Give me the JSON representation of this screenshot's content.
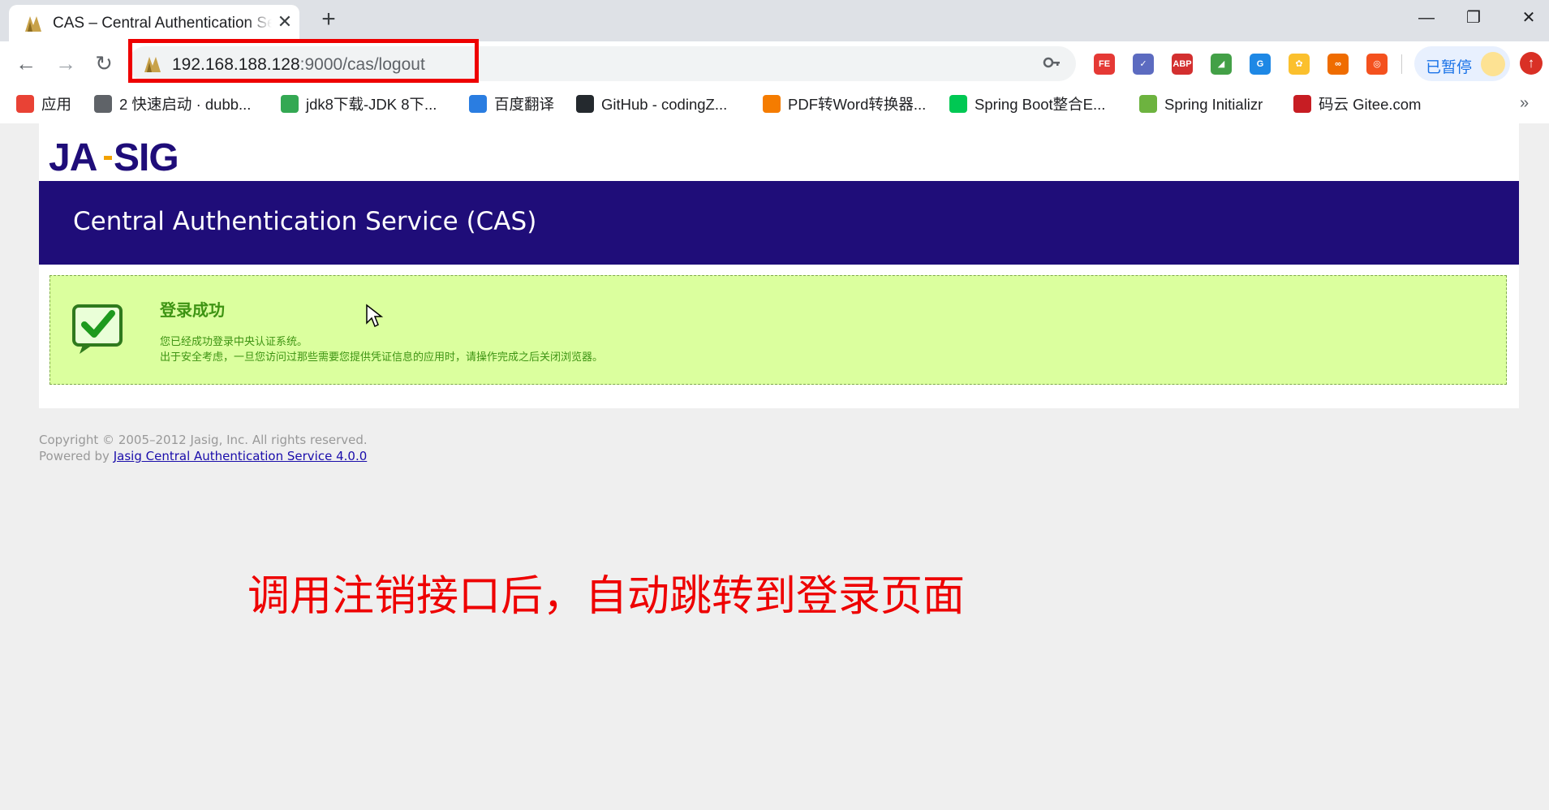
{
  "tab": {
    "title": "CAS – Central Authentication Service",
    "close": "✕"
  },
  "new_tab": "+",
  "window_controls": {
    "minimize": "—",
    "restore": "❐",
    "close": "✕"
  },
  "nav": {
    "back": "←",
    "forward": "→",
    "reload": "↻"
  },
  "omnibox": {
    "host": "192.168.188.128",
    "path": ":9000/cas/logout",
    "key_icon": "key-icon"
  },
  "extensions": [
    {
      "name": "fe-helper-icon",
      "label": "FE",
      "color": "#e53935"
    },
    {
      "name": "check-circle-icon",
      "label": "✓",
      "color": "#5c6bc0"
    },
    {
      "name": "adblock-icon",
      "label": "ABP",
      "color": "#d32f2f"
    },
    {
      "name": "color-picker-icon",
      "label": "◢",
      "color": "#43a047"
    },
    {
      "name": "translate-icon",
      "label": "G",
      "color": "#1e88e5"
    },
    {
      "name": "photos-icon",
      "label": "✿",
      "color": "#fbc02d"
    },
    {
      "name": "infinity-icon",
      "label": "∞",
      "color": "#ef6c00"
    },
    {
      "name": "lifebuoy-icon",
      "label": "◎",
      "color": "#f4511e"
    }
  ],
  "profile": {
    "label": "已暂停"
  },
  "update_badge": "↑",
  "bookmarks": [
    {
      "label": "应用",
      "icon": "apps-grid-icon",
      "color": "#e94235"
    },
    {
      "label": "2 快速启动 · dubb...",
      "icon": "book-icon",
      "color": "#5f6368"
    },
    {
      "label": "jdk8下载-JDK 8下...",
      "icon": "green-g-icon",
      "color": "#34a853"
    },
    {
      "label": "百度翻译",
      "icon": "translate-bookmark-icon",
      "color": "#2a7de1"
    },
    {
      "label": "GitHub - codingZ...",
      "icon": "github-icon",
      "color": "#24292e"
    },
    {
      "label": "PDF转Word转换器...",
      "icon": "pdf-plus-icon",
      "color": "#f57c00"
    },
    {
      "label": "Spring Boot整合E...",
      "icon": "iqiyi-icon",
      "color": "#00c853"
    },
    {
      "label": "Spring Initializr",
      "icon": "spring-icon",
      "color": "#6db33f"
    },
    {
      "label": "码云 Gitee.com",
      "icon": "gitee-icon",
      "color": "#c71d23"
    }
  ],
  "bookmarks_more": "»",
  "page": {
    "logo_text": "JA-SIG",
    "banner_title": "Central Authentication Service (CAS)",
    "success": {
      "title": "登录成功",
      "line1": "您已经成功登录中央认证系统。",
      "line2": "出于安全考虑，一旦您访问过那些需要您提供凭证信息的应用时，请操作完成之后关闭浏览器。"
    },
    "footer": {
      "copyright": "Copyright © 2005–2012 Jasig, Inc. All rights reserved.",
      "powered_by": "Powered by",
      "link_text": "Jasig Central Authentication Service 4.0.0"
    }
  },
  "annotation": "调用注销接口后，自动跳转到登录页面",
  "colors": {
    "banner": "#1f0d79",
    "success_bg": "#dbff9e",
    "success_text": "#3e9413",
    "highlight": "#ee0000"
  }
}
